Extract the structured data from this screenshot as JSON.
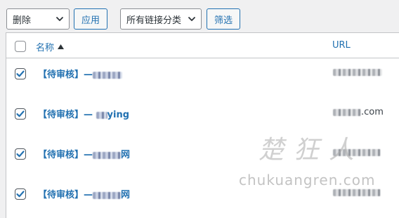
{
  "toolbar": {
    "bulk_action": "删除",
    "apply_label": "应用",
    "category_filter": "所有链接分类",
    "filter_label": "筛选"
  },
  "table": {
    "columns": {
      "name": "名称",
      "url": "URL"
    },
    "rows": [
      {
        "name_prefix": "【待审核】—",
        "name_visible": "",
        "url_visible": "",
        "checked": true
      },
      {
        "name_prefix": "【待审核】—",
        "name_visible": "ying",
        "url_visible": ".com",
        "checked": true
      },
      {
        "name_prefix": "【待审核】—",
        "name_visible": "网",
        "url_visible": "",
        "checked": true
      },
      {
        "name_prefix": "【待审核】—",
        "name_visible": "网",
        "url_visible": "",
        "checked": true
      }
    ]
  },
  "watermark": {
    "chinese": "楚狂人",
    "english": "chukuangren.com"
  },
  "colors": {
    "link": "#2271b1",
    "border": "#c3c4c7",
    "background": "#f0f0f1"
  },
  "icons": {
    "dropdown": "chevron-down-icon",
    "sort": "sort-ascending-icon",
    "checkbox": "checkmark-icon"
  }
}
